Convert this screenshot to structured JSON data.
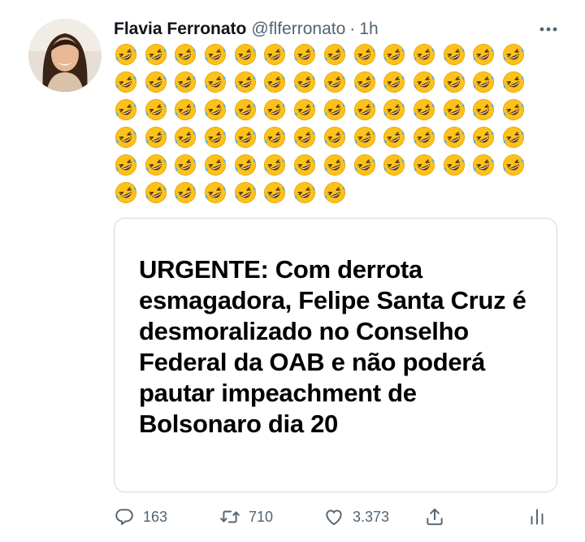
{
  "tweet": {
    "author_name": "Flavia Ferronato",
    "handle": "@flferronato",
    "separator": "·",
    "time": "1h",
    "emoji_name": "rolling-on-the-floor-laughing-emoji",
    "emoji_count": 78,
    "card": {
      "headline": "URGENTE: Com derrota esmagadora, Felipe Santa Cruz é desmoralizado no Conselho Federal da OAB e não poderá pautar impeachment de Bolsonaro dia 20"
    },
    "actions": {
      "replies": "163",
      "retweets": "710",
      "likes": "3.373"
    }
  },
  "icons": {
    "more": "more-dots-icon",
    "reply": "reply-bubble-icon",
    "retweet": "retweet-icon",
    "like": "heart-icon",
    "share": "share-icon",
    "analytics": "analytics-icon"
  },
  "colors": {
    "secondary_text": "#536471",
    "border": "#cfd9de",
    "emoji_face": "#fcc21b",
    "emoji_tear": "#4fafe8"
  }
}
